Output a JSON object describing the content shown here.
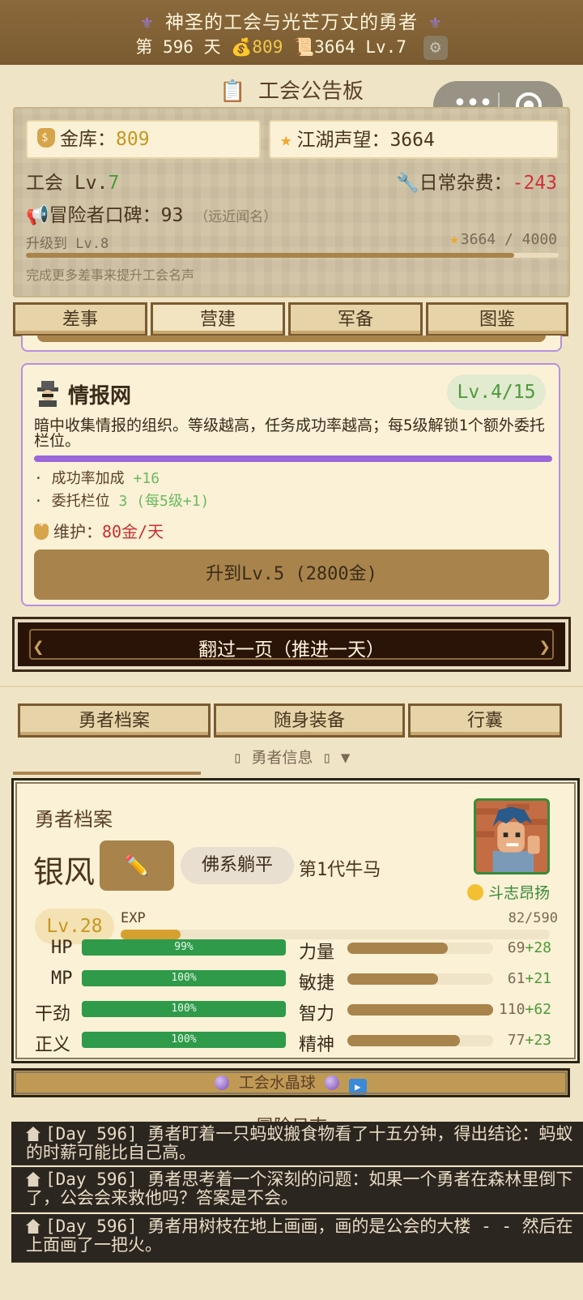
{
  "header": {
    "title": "神圣的工会与光芒万丈的勇者",
    "day_label": "第 596 天",
    "gold": "809",
    "fame": "3664",
    "level": "Lv.7"
  },
  "board": {
    "title": "工会公告板",
    "treasury_label": "金库：",
    "treasury_value": "809",
    "fame_label": "江湖声望：",
    "fame_value": "3664",
    "guild_label": "工会 Lv.",
    "guild_level": "7",
    "upkeep_label": "日常杂费：",
    "upkeep_value": "-243",
    "reputation_label": "冒险者口碑：",
    "reputation_value": "93",
    "reputation_desc": "（远近闻名）",
    "next_level_label": "升级到 Lv.8",
    "progress_text": "3664 / 4000",
    "progress_fraction": 0.916,
    "hint": "完成更多差事来提升工会名声"
  },
  "tabs": [
    {
      "label": "差事"
    },
    {
      "label": "营建"
    },
    {
      "label": "军备"
    },
    {
      "label": "图鉴"
    }
  ],
  "building": {
    "name": "情报网",
    "level_badge": "Lv.4/15",
    "description": "暗中收集情报的组织。等级越高，任务成功率越高；每5级解锁1个额外委托栏位。",
    "bullet1_label": "· 成功率加成 ",
    "bullet1_value": "+16",
    "bullet2_label": "· 委托栏位 ",
    "bullet2_value": "3 (每5级+1)",
    "upkeep_label": "维护：",
    "upkeep_value": "80金/天",
    "upgrade_label": "升到Lv.5 (2800金)"
  },
  "advance_label": "翻过一页（推进一天）",
  "hero_tabs": [
    {
      "label": "勇者档案"
    },
    {
      "label": "随身装备"
    },
    {
      "label": "行囊"
    }
  ],
  "hero_sub_label": "▯ 勇者信息 ▯ ▼",
  "hero": {
    "section_title": "勇者档案",
    "name": "银风",
    "edit_icon": "✏️",
    "trait": "佛系躺平",
    "generation": "第1代牛马",
    "mood": "斗志昂扬",
    "level": "Lv.28",
    "exp_label": "EXP",
    "exp_text": "82/590",
    "exp_fraction": 0.139,
    "vitals": [
      {
        "name": "HP",
        "percent_text": "99%"
      },
      {
        "name": "MP",
        "percent_text": "100%"
      },
      {
        "name": "干劲",
        "percent_text": "100%"
      },
      {
        "name": "正义",
        "percent_text": "100%"
      }
    ],
    "attributes": [
      {
        "name": "力量",
        "base": "69",
        "bonus": "+28",
        "fill": 0.69
      },
      {
        "name": "敏捷",
        "base": "61",
        "bonus": "+21",
        "fill": 0.62
      },
      {
        "name": "智力",
        "base": "110",
        "bonus": "+62",
        "fill": 1.0
      },
      {
        "name": "精神",
        "base": "77",
        "bonus": "+23",
        "fill": 0.77
      }
    ]
  },
  "crystal_label": "工会水晶球",
  "log": {
    "title": "--- 冒险日志 ---",
    "entries": [
      {
        "text": "[Day 596] 勇者盯着一只蚂蚁搬食物看了十五分钟，得出结论：蚂蚁的时薪可能比自己高。"
      },
      {
        "text": "[Day 596] 勇者思考着一个深刻的问题：如果一个勇者在森林里倒下了，公会会来救他吗？答案是不会。"
      },
      {
        "text": "[Day 596] 勇者用树枝在地上画画，画的是公会的大楼 - - 然后在上面画了一把火。"
      }
    ]
  },
  "colors": {
    "banner": "#7a5a30",
    "accent_purple": "#9b66d8",
    "hp_green": "#2e9a4a",
    "attr_brown": "#a8844c",
    "exp_gold": "#d6a030"
  }
}
